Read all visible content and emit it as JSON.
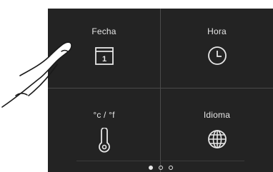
{
  "tiles": [
    {
      "label": "Fecha",
      "icon": "calendar-icon",
      "day": "1"
    },
    {
      "label": "Hora",
      "icon": "clock-icon"
    },
    {
      "label": "°c / °f",
      "icon": "thermometer-icon"
    },
    {
      "label": "Idioma",
      "icon": "globe-icon"
    }
  ],
  "pager": {
    "pages": 3,
    "active": 1
  },
  "colors": {
    "background": "#232323",
    "foreground": "#e6e6e6",
    "divider": "#4a4a4a"
  }
}
